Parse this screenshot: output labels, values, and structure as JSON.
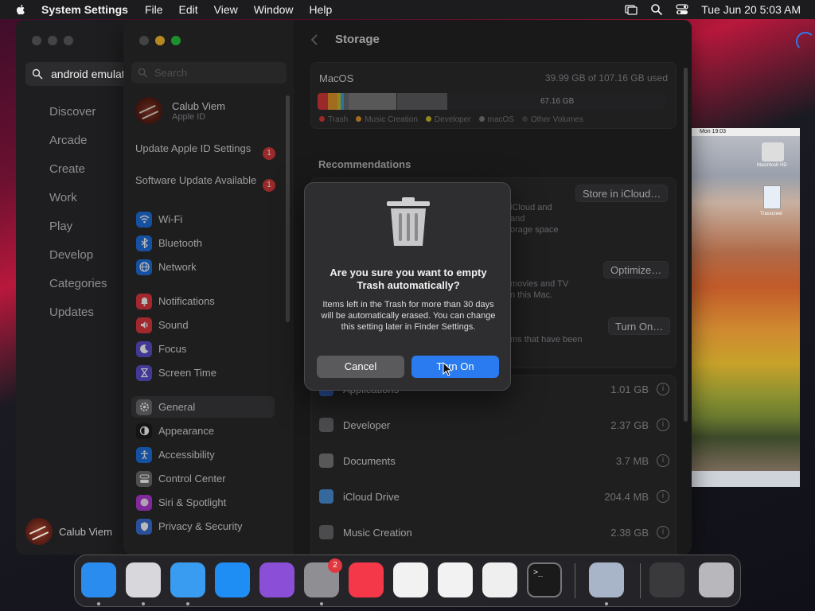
{
  "menubar": {
    "app_name": "System Settings",
    "items": [
      "File",
      "Edit",
      "View",
      "Window",
      "Help"
    ],
    "datetime": "Tue Jun 20  5:03 AM"
  },
  "appstore": {
    "search_value": "android emulat",
    "nav": [
      "Discover",
      "Arcade",
      "Create",
      "Work",
      "Play",
      "Develop",
      "Categories",
      "Updates"
    ],
    "user_name": "Calub Viem"
  },
  "sidebar": {
    "search_placeholder": "Search",
    "user_name": "Calub Viem",
    "user_sub": "Apple ID",
    "alerts": [
      {
        "label": "Update Apple ID Settings",
        "badge": "1"
      },
      {
        "label": "Software Update Available",
        "badge": "1"
      }
    ],
    "groups": [
      [
        {
          "label": "Wi-Fi",
          "color": "#1f6fe0"
        },
        {
          "label": "Bluetooth",
          "color": "#1f6fe0"
        },
        {
          "label": "Network",
          "color": "#1f6fe0"
        }
      ],
      [
        {
          "label": "Notifications",
          "color": "#e0383e"
        },
        {
          "label": "Sound",
          "color": "#e0383e"
        },
        {
          "label": "Focus",
          "color": "#5a4fcf"
        },
        {
          "label": "Screen Time",
          "color": "#5a4fcf"
        }
      ],
      [
        {
          "label": "General",
          "color": "#6e6e72"
        },
        {
          "label": "Appearance",
          "color": "#1c1c1e"
        },
        {
          "label": "Accessibility",
          "color": "#1f6fe0"
        },
        {
          "label": "Control Center",
          "color": "#6e6e72"
        },
        {
          "label": "Siri & Spotlight",
          "color": "#b03ad6"
        },
        {
          "label": "Privacy & Security",
          "color": "#3a6fd6"
        }
      ]
    ],
    "selected": "General"
  },
  "main": {
    "title": "Storage",
    "storage": {
      "volume": "MacOS",
      "used": "39.99 GB of 107.16 GB used",
      "free_label": "67.16 GB",
      "used_fraction": 0.373,
      "legend": [
        {
          "label": "Trash",
          "color": "#d63b3b"
        },
        {
          "label": "Music Creation",
          "color": "#e0962a"
        },
        {
          "label": "Developer",
          "color": "#c8c02a"
        },
        {
          "label": "macOS",
          "color": "#7a7a7c"
        },
        {
          "label": "Other Volumes",
          "color": "#4a4a4c"
        }
      ]
    },
    "recommendations_title": "Recommendations",
    "rec_buttons": [
      "Store in iCloud…",
      "Optimize…",
      "Turn On…"
    ],
    "rec_fragments": [
      "iCloud and",
      "and",
      "orage space",
      "movies and TV",
      "n this Mac.",
      "ms that have been"
    ],
    "rows": [
      {
        "label": "Applications",
        "size": "1.01 GB"
      },
      {
        "label": "Developer",
        "size": "2.37 GB"
      },
      {
        "label": "Documents",
        "size": "3.7 MB"
      },
      {
        "label": "iCloud Drive",
        "size": "204.4 MB"
      },
      {
        "label": "Music Creation",
        "size": "2.38 GB"
      }
    ]
  },
  "dialog": {
    "title": "Are you sure you want to empty Trash automatically?",
    "message": "Items left in the Trash for more than 30 days will be automatically erased. You can change this setting later in Finder Settings.",
    "cancel_label": "Cancel",
    "ok_label": "Turn On"
  },
  "thumbnail": {
    "menubar_text": "Mon 19:03",
    "disk_label": "Macintosh HD",
    "doc_label": "Trasscreel"
  },
  "dock": {
    "badge_settings": "2",
    "apps": [
      {
        "name": "finder-icon",
        "color": "#2b8cf0"
      },
      {
        "name": "launchpad-icon",
        "color": "#d8d8dc"
      },
      {
        "name": "safari-icon",
        "color": "#3a9cf0"
      },
      {
        "name": "app-store-icon",
        "color": "#1e8ef5"
      },
      {
        "name": "podcasts-icon",
        "color": "#8a4fd6"
      },
      {
        "name": "system-settings-icon",
        "color": "#8e8e93"
      },
      {
        "name": "music-icon",
        "color": "#f5374a"
      },
      {
        "name": "freeform-icon",
        "color": "#f2f2f2"
      },
      {
        "name": "photos-icon",
        "color": "#f2f2f2"
      },
      {
        "name": "textedit-icon",
        "color": "#efefef"
      },
      {
        "name": "terminal-icon",
        "color": "#1a1a1a"
      },
      {
        "name": "preview-finder-icon",
        "color": "#a8b4c8"
      },
      {
        "name": "screenshot-stack-icon",
        "color": "#3a3a3c"
      },
      {
        "name": "trash-icon",
        "color": "#b8b8bc"
      }
    ]
  }
}
